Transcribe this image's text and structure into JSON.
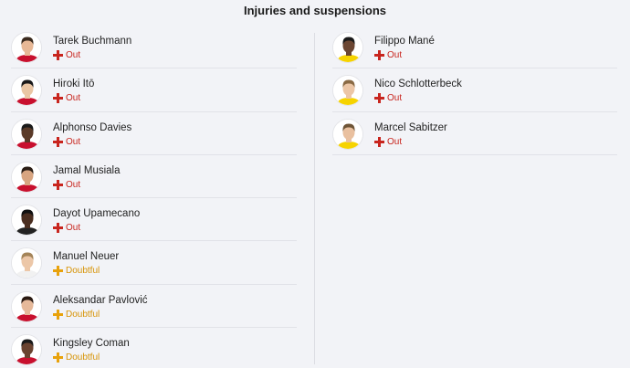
{
  "title": "Injuries and suspensions",
  "colors": {
    "out": "#c8251e",
    "doubtful": "#e8a20c"
  },
  "left": [
    {
      "name": "Tarek Buchmann",
      "status": "Out",
      "type": "out",
      "skin": "#e8b896",
      "hair": "#3a2a1e",
      "shirt": "#c8102e"
    },
    {
      "name": "Hiroki Itō",
      "status": "Out",
      "type": "out",
      "skin": "#eac6a4",
      "hair": "#1a1a1a",
      "shirt": "#c8102e"
    },
    {
      "name": "Alphonso Davies",
      "status": "Out",
      "type": "out",
      "skin": "#5a3a28",
      "hair": "#1a1a1a",
      "shirt": "#c8102e"
    },
    {
      "name": "Jamal Musiala",
      "status": "Out",
      "type": "out",
      "skin": "#d8a581",
      "hair": "#2a1d15",
      "shirt": "#c8102e"
    },
    {
      "name": "Dayot Upamecano",
      "status": "Out",
      "type": "out",
      "skin": "#4a2e20",
      "hair": "#111111",
      "shirt": "#222222"
    },
    {
      "name": "Manuel Neuer",
      "status": "Doubtful",
      "type": "doubtful",
      "skin": "#ecc7a8",
      "hair": "#a48458",
      "shirt": "#f1f1f1"
    },
    {
      "name": "Aleksandar Pavlović",
      "status": "Doubtful",
      "type": "doubtful",
      "skin": "#e6b99a",
      "hair": "#2a1a12",
      "shirt": "#c8102e"
    },
    {
      "name": "Kingsley Coman",
      "status": "Doubtful",
      "type": "doubtful",
      "skin": "#6a4330",
      "hair": "#1a1a1a",
      "shirt": "#c8102e"
    }
  ],
  "right": [
    {
      "name": "Filippo Mané",
      "status": "Out",
      "type": "out",
      "skin": "#6b4632",
      "hair": "#1a1a1a",
      "shirt": "#f6d300"
    },
    {
      "name": "Nico Schlotterbeck",
      "status": "Out",
      "type": "out",
      "skin": "#ecc6a6",
      "hair": "#8a6a44",
      "shirt": "#f6d300"
    },
    {
      "name": "Marcel Sabitzer",
      "status": "Out",
      "type": "out",
      "skin": "#e9c09f",
      "hair": "#6e5436",
      "shirt": "#f6d300"
    }
  ]
}
